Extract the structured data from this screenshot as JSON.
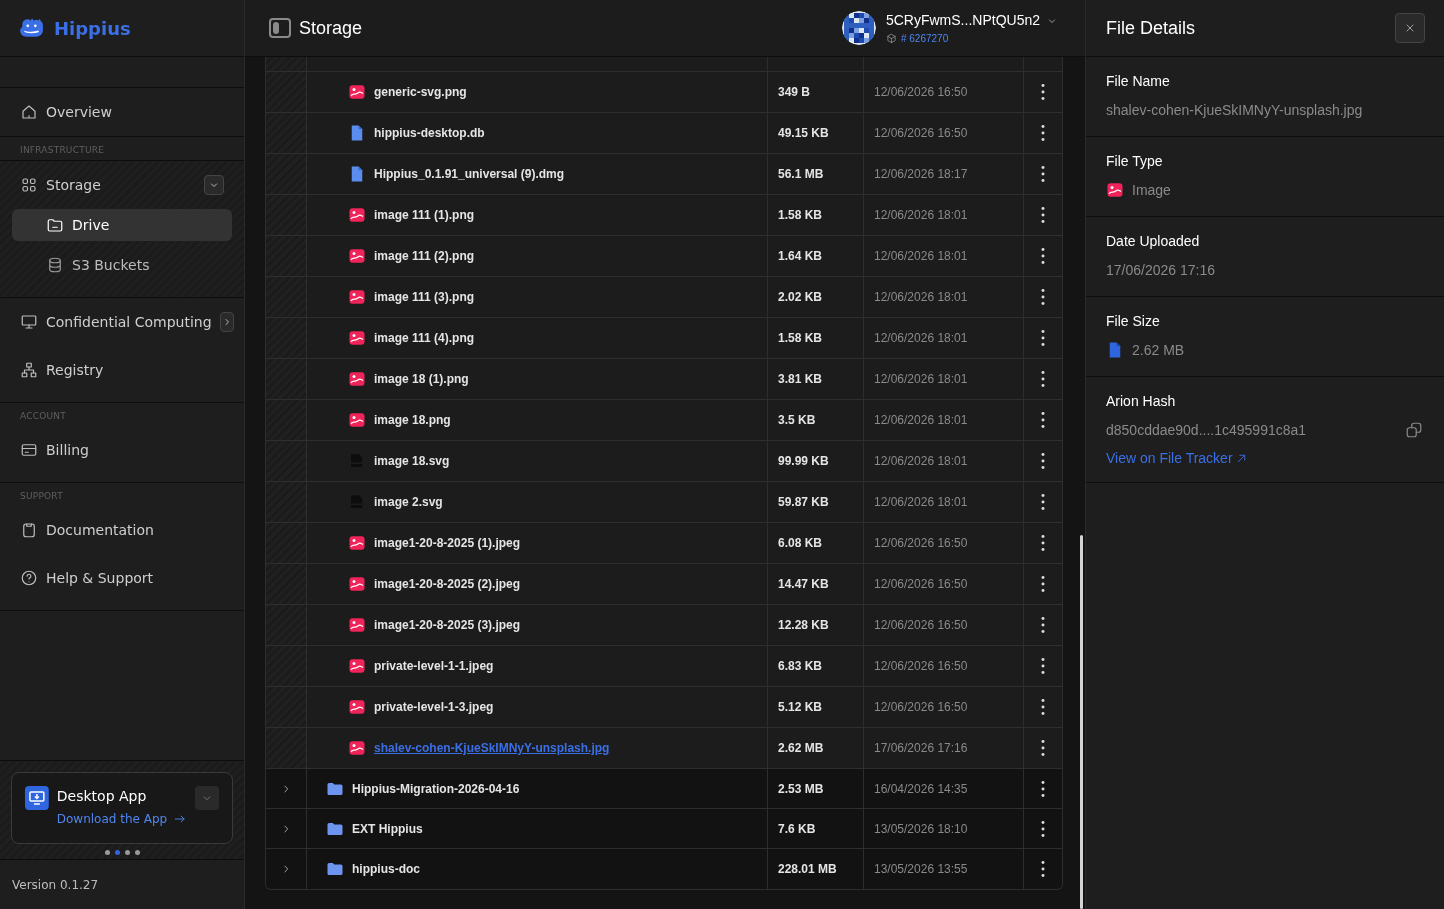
{
  "brand": {
    "name": "Hippius"
  },
  "sidebar": {
    "sections": [
      {
        "items": [
          {
            "label": "Overview",
            "selected": false
          }
        ]
      },
      {
        "heading": "INFRASTRUCTURE",
        "items": [
          {
            "label": "Storage",
            "selected": false,
            "expanded": true,
            "children": [
              {
                "label": "Drive",
                "selected": true
              },
              {
                "label": "S3 Buckets",
                "selected": false
              }
            ]
          },
          {
            "label": "Confidential Computing",
            "selected": false,
            "expanded": false
          },
          {
            "label": "Registry",
            "selected": false
          }
        ]
      },
      {
        "heading": "ACCOUNT",
        "items": [
          {
            "label": "Billing",
            "selected": false
          }
        ]
      },
      {
        "heading": "SUPPORT",
        "items": [
          {
            "label": "Documentation",
            "selected": false
          },
          {
            "label": "Help & Support",
            "selected": false
          }
        ]
      }
    ],
    "promo": {
      "title": "Desktop App",
      "link": "Download the App",
      "dots": [
        {
          "selected": false
        },
        {
          "selected": true
        },
        {
          "selected": false
        },
        {
          "selected": false
        }
      ]
    },
    "version": "Version 0.1.27"
  },
  "header": {
    "title": "Storage",
    "account": "5CRyFwmS...NPtQU5n2",
    "block": "# 6267270"
  },
  "table": {
    "rows": [
      {
        "kind": "image",
        "name": "generic-svg.png",
        "size": "349 B",
        "date": "12/06/2026 16:50",
        "selected": false
      },
      {
        "kind": "document",
        "name": "hippius-desktop.db",
        "size": "49.15 KB",
        "date": "12/06/2026 16:50",
        "selected": false
      },
      {
        "kind": "document",
        "name": "Hippius_0.1.91_universal (9).dmg",
        "size": "56.1 MB",
        "date": "12/06/2026 18:17",
        "selected": false
      },
      {
        "kind": "image",
        "name": "image 111 (1).png",
        "size": "1.58 KB",
        "date": "12/06/2026 18:01",
        "selected": false
      },
      {
        "kind": "image",
        "name": "image 111 (2).png",
        "size": "1.64 KB",
        "date": "12/06/2026 18:01",
        "selected": false
      },
      {
        "kind": "image",
        "name": "image 111 (3).png",
        "size": "2.02 KB",
        "date": "12/06/2026 18:01",
        "selected": false
      },
      {
        "kind": "image",
        "name": "image 111 (4).png",
        "size": "1.58 KB",
        "date": "12/06/2026 18:01",
        "selected": false
      },
      {
        "kind": "image",
        "name": "image 18 (1).png",
        "size": "3.81 KB",
        "date": "12/06/2026 18:01",
        "selected": false
      },
      {
        "kind": "image",
        "name": "image 18.png",
        "size": "3.5 KB",
        "date": "12/06/2026 18:01",
        "selected": false
      },
      {
        "kind": "svg",
        "name": "image 18.svg",
        "size": "99.99 KB",
        "date": "12/06/2026 18:01",
        "selected": false
      },
      {
        "kind": "svg",
        "name": "image 2.svg",
        "size": "59.87 KB",
        "date": "12/06/2026 18:01",
        "selected": false
      },
      {
        "kind": "image",
        "name": "image1-20-8-2025 (1).jpeg",
        "size": "6.08 KB",
        "date": "12/06/2026 16:50",
        "selected": false
      },
      {
        "kind": "image",
        "name": "image1-20-8-2025 (2).jpeg",
        "size": "14.47 KB",
        "date": "12/06/2026 16:50",
        "selected": false
      },
      {
        "kind": "image",
        "name": "image1-20-8-2025 (3).jpeg",
        "size": "12.28 KB",
        "date": "12/06/2026 16:50",
        "selected": false
      },
      {
        "kind": "image",
        "name": "private-level-1-1.jpeg",
        "size": "6.83 KB",
        "date": "12/06/2026 16:50",
        "selected": false
      },
      {
        "kind": "image",
        "name": "private-level-1-3.jpeg",
        "size": "5.12 KB",
        "date": "12/06/2026 16:50",
        "selected": false
      },
      {
        "kind": "image",
        "name": "shalev-cohen-KjueSkIMNyY-unsplash.jpg",
        "size": "2.62 MB",
        "date": "17/06/2026 17:16",
        "selected": true
      },
      {
        "kind": "folder",
        "name": "Hippius-Migration-2026-04-16",
        "size": "2.53 MB",
        "date": "16/04/2026 14:35",
        "selected": false,
        "expanded": false
      },
      {
        "kind": "folder",
        "name": "EXT Hippius",
        "size": "7.6 KB",
        "date": "13/05/2026 18:10",
        "selected": false,
        "expanded": false
      },
      {
        "kind": "folder",
        "name": "hippius-doc",
        "size": "228.01 MB",
        "date": "13/05/2026 13:55",
        "selected": false,
        "expanded": false
      }
    ]
  },
  "details": {
    "title": "File Details",
    "fields": [
      {
        "kind": "text",
        "label": "File Name",
        "value": "shalev-cohen-KjueSkIMNyY-unsplash.jpg"
      },
      {
        "kind": "type",
        "label": "File Type",
        "value": "Image"
      },
      {
        "kind": "text",
        "label": "Date Uploaded",
        "value": "17/06/2026 17:16"
      },
      {
        "kind": "size",
        "label": "File Size",
        "value": "2.62 MB"
      },
      {
        "kind": "hash",
        "label": "Arion Hash",
        "value": "d850cddae90d....1c495991c8a1",
        "link": "View on File Tracker"
      }
    ]
  }
}
